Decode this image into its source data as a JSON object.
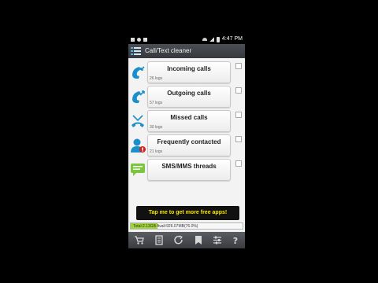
{
  "status_bar": {
    "time": "4:47 PM"
  },
  "app": {
    "title": "Call/Text cleaner"
  },
  "rows": [
    {
      "label": "Incoming calls",
      "count": "26 logs",
      "icon": "incoming-call-icon"
    },
    {
      "label": "Outgoing calls",
      "count": "57 logs",
      "icon": "outgoing-call-icon"
    },
    {
      "label": "Missed calls",
      "count": "30 logs",
      "icon": "missed-call-icon"
    },
    {
      "label": "Frequently contacted",
      "count": "21 logs",
      "icon": "contact-icon"
    },
    {
      "label": "SMS/MMS threads",
      "count": "",
      "icon": "sms-icon"
    }
  ],
  "promo": {
    "label": "Tap me to get more free apps!"
  },
  "storage": {
    "label": "Total:2.13GB  Avail:926.07MB(76.0%)",
    "used_fraction": 0.24
  },
  "bottom_bar": [
    "cart-icon",
    "document-icon",
    "refresh-icon",
    "bookmark-icon",
    "settings-icon",
    "help-icon"
  ],
  "colors": {
    "accent": "#1a8fc9",
    "promo_text": "#f7e600",
    "storage_fill": "#9fd43a"
  }
}
